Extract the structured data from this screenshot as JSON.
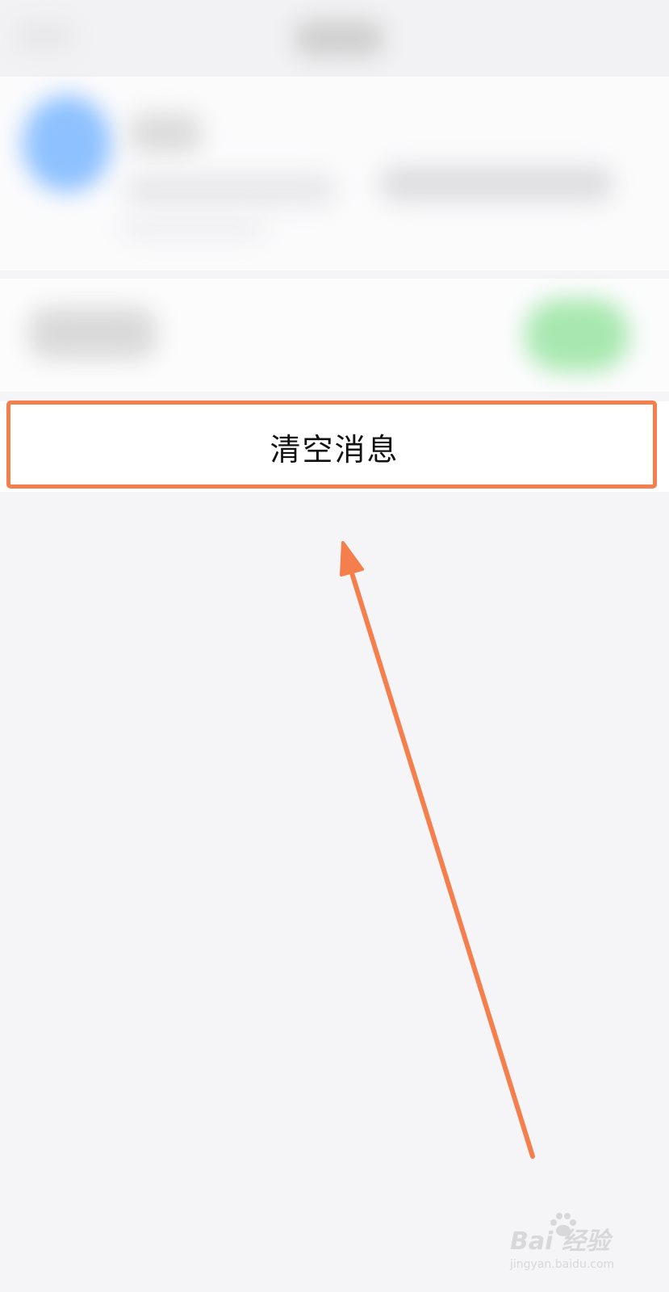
{
  "clear_messages": {
    "label": "清空消息"
  },
  "colors": {
    "annotation": "#f47f4d",
    "avatar": "#8ec1ff",
    "switch_on": "#a8e8b0",
    "background": "#f5f4f6"
  },
  "watermark": {
    "brand": "Bai  经验",
    "url": "jingyan.baidu.com",
    "icon": "paw-icon"
  }
}
